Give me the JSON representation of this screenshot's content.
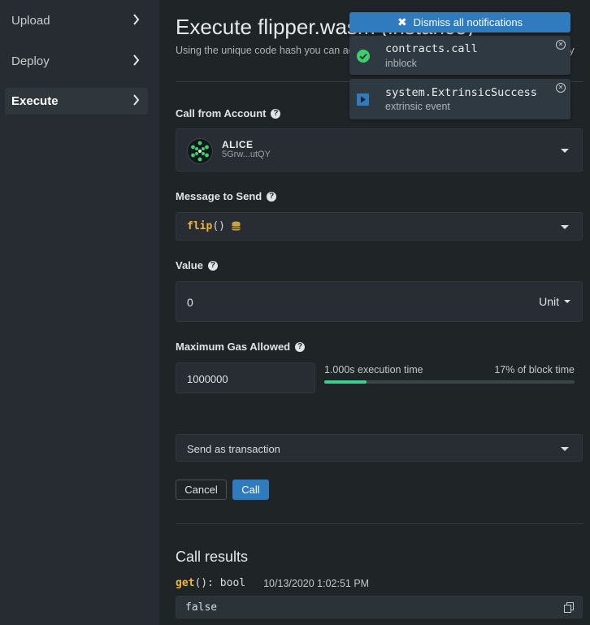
{
  "sidebar": {
    "items": [
      {
        "label": "Upload"
      },
      {
        "label": "Deploy"
      },
      {
        "label": "Execute"
      }
    ]
  },
  "header": {
    "title": "Execute flipper.wasm (instance)",
    "subtitle": "Using the unique code hash you can add on-chain contract code for you or you to deploy"
  },
  "account": {
    "label": "Call from Account",
    "name": "ALICE",
    "address": "5Grw...utQY"
  },
  "message": {
    "label": "Message to Send",
    "fn": "flip",
    "parens": "()"
  },
  "value": {
    "label": "Value",
    "amount": "0",
    "unit": "Unit"
  },
  "gas": {
    "label": "Maximum Gas Allowed",
    "amount": "1000000",
    "exec_time": "1.000s execution time",
    "block_pct": "17% of block time",
    "fill_percent": 17
  },
  "send_mode": {
    "selected": "Send as transaction"
  },
  "buttons": {
    "cancel": "Cancel",
    "call": "Call"
  },
  "results": {
    "title": "Call results",
    "fn": "get",
    "signature": "(): bool",
    "timestamp": "10/13/2020 1:02:51 PM",
    "output": "false"
  },
  "notifications": {
    "dismiss_all": "Dismiss all notifications",
    "items": [
      {
        "title": "contracts.call",
        "status": "inblock",
        "icon": "check-circle-icon"
      },
      {
        "title": "system.ExtrinsicSuccess",
        "status": "extrinsic event",
        "icon": "play-square-icon"
      }
    ]
  },
  "colors": {
    "accent": "#2f7bbd",
    "success": "#3ccf6a",
    "gold": "#f0b43a",
    "progress": "#3ccf8e"
  }
}
